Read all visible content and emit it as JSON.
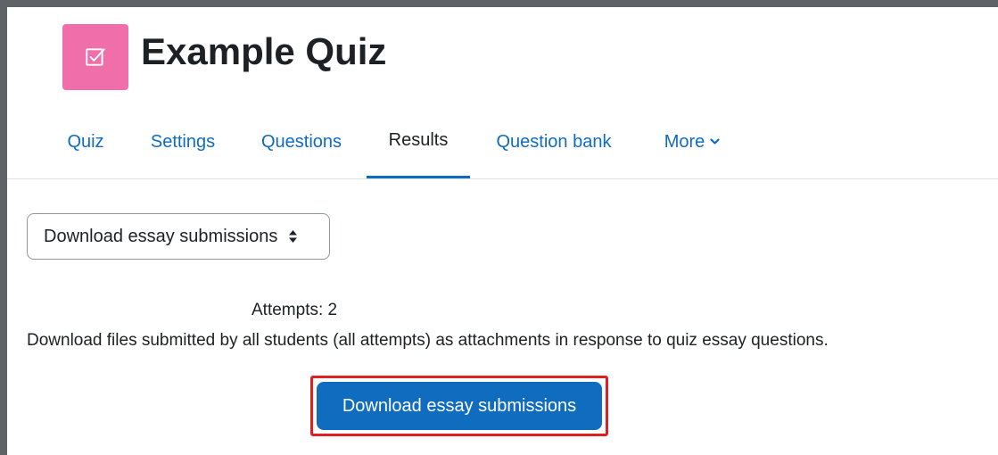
{
  "header": {
    "title": "Example Quiz",
    "icon": "quiz-checkbox-icon",
    "icon_color": "#f06ea9"
  },
  "nav": {
    "tabs": [
      {
        "label": "Quiz"
      },
      {
        "label": "Settings"
      },
      {
        "label": "Questions"
      },
      {
        "label": "Results",
        "active": true
      },
      {
        "label": "Question bank"
      },
      {
        "label": "More"
      }
    ]
  },
  "report_select": {
    "selected": "Download essay submissions"
  },
  "content": {
    "attempts": "Attempts: 2",
    "description": "Download files submitted by all students (all attempts) as attachments in response to quiz essay questions.",
    "button_label": "Download essay submissions"
  },
  "colors": {
    "link": "#0f6cbf",
    "primary_button": "#0f6cbf",
    "highlight_border": "#e02020"
  }
}
